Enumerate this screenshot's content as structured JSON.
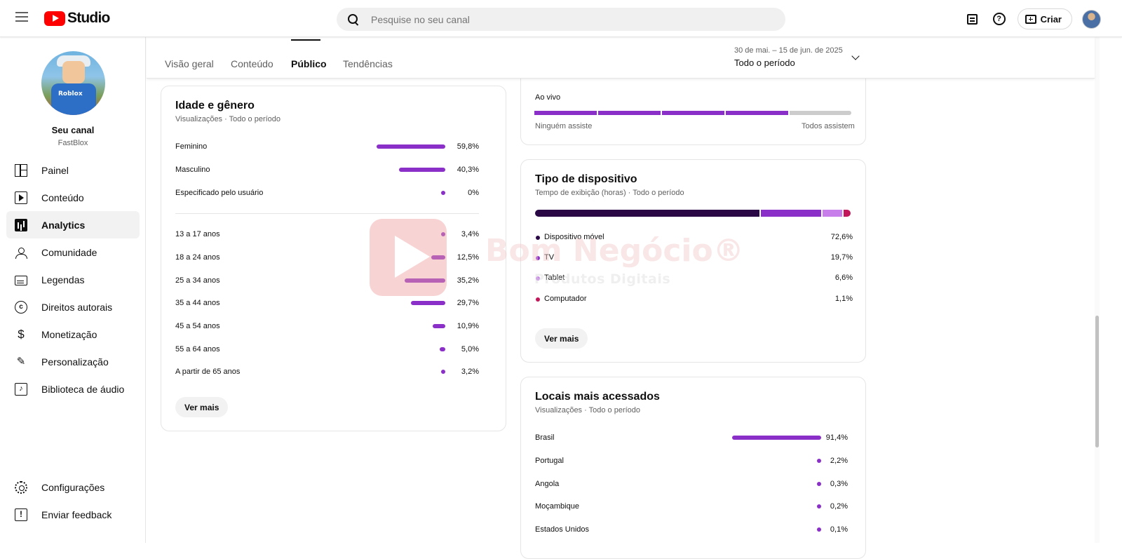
{
  "header": {
    "app_name": "Studio",
    "search_placeholder": "Pesquise no seu canal",
    "create_label": "Criar"
  },
  "channel": {
    "title": "Seu canal",
    "handle": "FastBlox",
    "avatar_shirt_text": "Roblox"
  },
  "sidebar": {
    "items": [
      {
        "label": "Painel",
        "icon": "dashboard-icon"
      },
      {
        "label": "Conteúdo",
        "icon": "content-icon"
      },
      {
        "label": "Analytics",
        "icon": "analytics-icon",
        "active": true
      },
      {
        "label": "Comunidade",
        "icon": "community-icon"
      },
      {
        "label": "Legendas",
        "icon": "subtitles-icon"
      },
      {
        "label": "Direitos autorais",
        "icon": "copyright-icon"
      },
      {
        "label": "Monetização",
        "icon": "monetization-icon"
      },
      {
        "label": "Personalização",
        "icon": "customization-icon"
      },
      {
        "label": "Biblioteca de áudio",
        "icon": "audio-library-icon"
      }
    ],
    "bottom_items": [
      {
        "label": "Configurações",
        "icon": "settings-icon"
      },
      {
        "label": "Enviar feedback",
        "icon": "feedback-icon"
      }
    ]
  },
  "tabs": [
    {
      "label": "Visão geral"
    },
    {
      "label": "Conteúdo"
    },
    {
      "label": "Público",
      "active": true
    },
    {
      "label": "Tendências"
    }
  ],
  "period": {
    "range": "30 de mai. – 15 de jun. de 2025",
    "label": "Todo o período"
  },
  "age_gender": {
    "title": "Idade e gênero",
    "subtitle": "Visualizações · Todo o período",
    "gender": [
      {
        "label": "Feminino",
        "value": "59,8%",
        "pct": 59.8
      },
      {
        "label": "Masculino",
        "value": "40,3%",
        "pct": 40.3
      },
      {
        "label": "Especificado pelo usuário",
        "value": "0%",
        "pct": 0
      }
    ],
    "ages": [
      {
        "label": "13 a 17 anos",
        "value": "3,4%",
        "pct": 3.4
      },
      {
        "label": "18 a 24 anos",
        "value": "12,5%",
        "pct": 12.5
      },
      {
        "label": "25 a 34 anos",
        "value": "35,2%",
        "pct": 35.2
      },
      {
        "label": "35 a 44 anos",
        "value": "29,7%",
        "pct": 29.7
      },
      {
        "label": "45 a 54 anos",
        "value": "10,9%",
        "pct": 10.9
      },
      {
        "label": "55 a 64 anos",
        "value": "5,0%",
        "pct": 5.0
      },
      {
        "label": "A partir de 65 anos",
        "value": "3,2%",
        "pct": 3.2
      }
    ],
    "more_label": "Ver mais"
  },
  "live": {
    "label": "Ao vivo",
    "filled_segments": 4,
    "total_segments": 5,
    "left_caption": "Ninguém assiste",
    "right_caption": "Todos assistem"
  },
  "device": {
    "title": "Tipo de dispositivo",
    "subtitle": "Tempo de exibição (horas) · Todo o período",
    "items": [
      {
        "label": "Dispositivo móvel",
        "value": "72,6%",
        "pct": 72.6,
        "color": "#2a0845"
      },
      {
        "label": "TV",
        "value": "19,7%",
        "pct": 19.7,
        "color": "#8b2fc9"
      },
      {
        "label": "Tablet",
        "value": "6,6%",
        "pct": 6.6,
        "color": "#c77dea"
      },
      {
        "label": "Computador",
        "value": "1,1%",
        "pct": 1.1,
        "color": "#c2185b"
      }
    ],
    "more_label": "Ver mais"
  },
  "locations": {
    "title": "Locais mais acessados",
    "subtitle": "Visualizações · Todo o período",
    "items": [
      {
        "label": "Brasil",
        "value": "91,4%",
        "pct": 91.4
      },
      {
        "label": "Portugal",
        "value": "2,2%",
        "pct": 2.2
      },
      {
        "label": "Angola",
        "value": "0,3%",
        "pct": 0.3
      },
      {
        "label": "Moçambique",
        "value": "0,2%",
        "pct": 0.2
      },
      {
        "label": "Estados Unidos",
        "value": "0,1%",
        "pct": 0.1
      }
    ]
  },
  "watermark": {
    "title": "Bom Negócio®",
    "subtitle": "Produtos Digitais"
  },
  "colors": {
    "accent_bar": "#8b2fc9",
    "live_empty": "#cccccc",
    "brand_red": "#ff0000"
  }
}
